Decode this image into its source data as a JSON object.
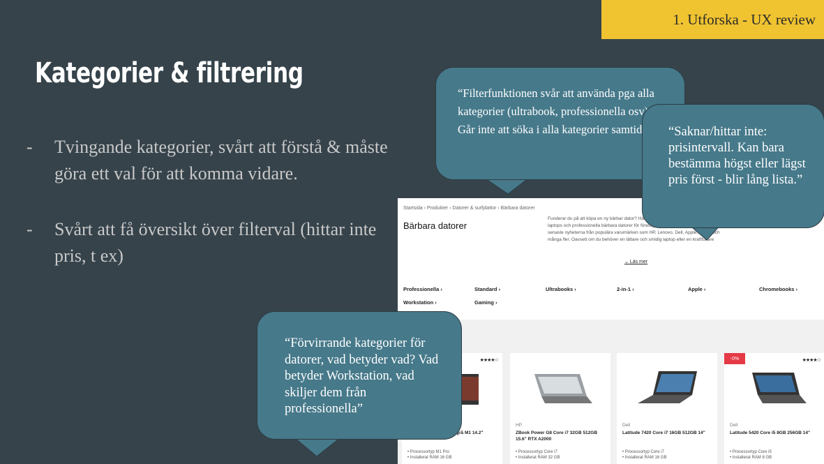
{
  "section_tag": "1. Utforska - UX review",
  "slide_title": "Kategorier & filtrering",
  "bullets": [
    {
      "marker": "-",
      "text": "Tvingande kategorier, svårt att förstå & måste göra ett val för att komma vidare."
    },
    {
      "marker": "-",
      "text": "Svårt att få översikt över filterval (hittar inte pris, t ex)"
    }
  ],
  "quotes": {
    "filter": "“Filterfunktionen svår att använda pga alla kategorier (ultrabook, professionella osv)  Går inte att söka i alla kategorier samtidigt.”",
    "price": "“Saknar/hittar inte: prisintervall. Kan bara bestämma högst eller lägst pris först - blir lång lista.”",
    "categories": "“Förvirrande kategorier för datorer, vad betyder vad? Vad betyder Workstation, vad skiljer dem från professionella”"
  },
  "screenshot": {
    "breadcrumb": "Startsida › Produkter › Datorer & surfplattor › Bärbara datorer",
    "page_title": "Bärbara datorer",
    "description": "Funderar du på att köpa en ny bärbar dator? Här hittar du ett brett sortiment av prisvärda laptops och professionella bärbara datorer för företaget, både Mac och PC. Vi har de senaste nyheterna från populära varumärken som HP, Lenovo, Dell, Apple, ASUS och många fler. Oavsett om du behöver en lättare och smidig laptop eller en kraftfullare",
    "read_more": "Läs mer",
    "categories": [
      "Professionella ›",
      "Standard ›",
      "Ultrabooks ›",
      "2-in-1 ›",
      "Apple ›",
      "Chromebooks ›",
      "Workstation ›",
      "Gaming ›"
    ],
    "products": [
      {
        "brand": "",
        "name": "Rymdgrå M1 14.2\"",
        "specs": "• Processortyp M1 Pro\n• Installerat RAM 16 GB",
        "stars": "★★★★☆",
        "badge": ""
      },
      {
        "brand": "HP",
        "name": "ZBook Power G8 Core i7 32GB 512GB 15.6\" RTX A2000",
        "specs": "• Processortyp Core i7\n• Installerat RAM 32 GB",
        "stars": "",
        "badge": ""
      },
      {
        "brand": "Dell",
        "name": "Latitude 7420 Core i7 16GB 512GB 14\"",
        "specs": "• Processortyp Core i7\n• Installerat RAM 16 GB",
        "stars": "",
        "badge": ""
      },
      {
        "brand": "Dell",
        "name": "Latitude 5420 Core i5 8GB 256GB 14\"",
        "specs": "• Processortyp Core i5\n• Installerat RAM 8 GB",
        "stars": "★★★★☆",
        "badge": "-0%"
      }
    ]
  },
  "colors": {
    "background": "#36434b",
    "tag": "#f0c330",
    "bubble": "#46798a"
  }
}
